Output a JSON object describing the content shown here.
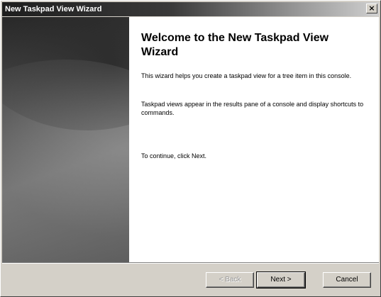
{
  "window": {
    "title": "New Taskpad View Wizard",
    "close_label": "×"
  },
  "content": {
    "heading": "Welcome to the New Taskpad View Wizard",
    "paragraph1": "This wizard helps you create a taskpad view for a tree item in this console.",
    "paragraph2": "Taskpad views appear in the results pane of a console and display shortcuts to commands.",
    "paragraph3": "To continue, click Next."
  },
  "buttons": {
    "back": "< Back",
    "next": "Next >",
    "cancel": "Cancel"
  }
}
